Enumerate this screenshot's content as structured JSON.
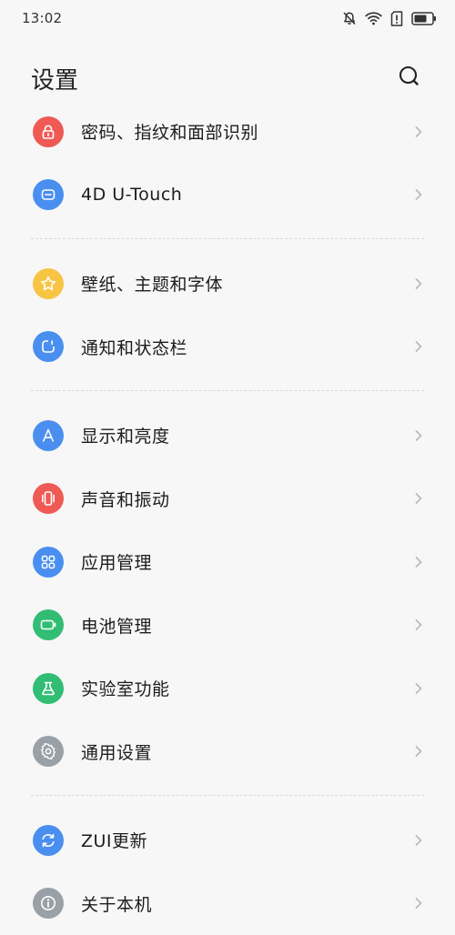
{
  "status_bar": {
    "time": "13:02",
    "icons": [
      "bell-muted-icon",
      "wifi-icon",
      "sim-alert-icon",
      "battery-icon"
    ]
  },
  "header": {
    "title": "设置",
    "search_icon": "search-icon"
  },
  "colors": {
    "red": "#ef5a55",
    "blue": "#4a8ff0",
    "yellow": "#f8c443",
    "green": "#32bd74",
    "gray": "#9aa0a8",
    "background": "#f7f7f7"
  },
  "groups": [
    {
      "items": [
        {
          "label": "密码、指纹和面部识别",
          "icon": "lock-icon",
          "color": "#ef5a55"
        },
        {
          "label": "4D U-Touch",
          "icon": "utouch-icon",
          "color": "#4a8ff0"
        }
      ]
    },
    {
      "items": [
        {
          "label": "壁纸、主题和字体",
          "icon": "star-icon",
          "color": "#f8c443"
        },
        {
          "label": "通知和状态栏",
          "icon": "notification-icon",
          "color": "#4a8ff0"
        }
      ]
    },
    {
      "items": [
        {
          "label": "显示和亮度",
          "icon": "display-icon",
          "color": "#4a8ff0"
        },
        {
          "label": "声音和振动",
          "icon": "vibration-icon",
          "color": "#ef5a55"
        },
        {
          "label": "应用管理",
          "icon": "apps-icon",
          "color": "#4a8ff0"
        },
        {
          "label": "电池管理",
          "icon": "battery-manage-icon",
          "color": "#32bd74"
        },
        {
          "label": "实验室功能",
          "icon": "flask-icon",
          "color": "#32bd74"
        },
        {
          "label": "通用设置",
          "icon": "gear-icon",
          "color": "#9aa0a8"
        }
      ]
    },
    {
      "items": [
        {
          "label": "ZUI更新",
          "icon": "update-icon",
          "color": "#4a8ff0"
        },
        {
          "label": "关于本机",
          "icon": "info-icon",
          "color": "#9aa0a8"
        }
      ]
    }
  ]
}
